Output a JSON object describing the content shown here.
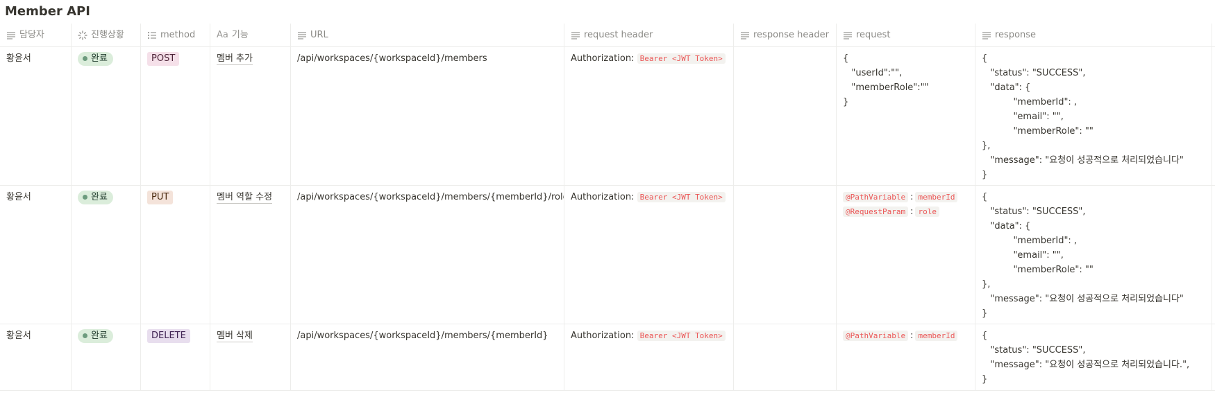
{
  "page": {
    "title": "Member API"
  },
  "columns": [
    {
      "label": "담당자",
      "icon": "text-lines-icon"
    },
    {
      "label": "진행상황",
      "icon": "status-spinner-icon"
    },
    {
      "label": "method",
      "icon": "list-icon"
    },
    {
      "label": "기능",
      "icon": "title-aa-icon",
      "prefix": "Aa"
    },
    {
      "label": "URL",
      "icon": "text-lines-icon"
    },
    {
      "label": "request header",
      "icon": "text-lines-icon"
    },
    {
      "label": "response header",
      "icon": "text-lines-icon"
    },
    {
      "label": "request",
      "icon": "text-lines-icon"
    },
    {
      "label": "response",
      "icon": "text-lines-icon"
    }
  ],
  "rows": [
    {
      "owner": "황윤서",
      "status": "완료",
      "method": "POST",
      "feature": "멤버 추가",
      "url": "/api/workspaces/{workspaceId}/members",
      "request_header": {
        "key": "Authorization:",
        "value": "Bearer <JWT Token>"
      },
      "response_header": "",
      "request": "{\n   \"userId\":\"\",\n   \"memberRole\":\"\"\n}",
      "response": "{\n   \"status\": \"SUCCESS\",\n   \"data\": {\n           \"memberId\": ,\n           \"email\": \"\",\n           \"memberRole\": \"\"\n},\n   \"message\": \"요청이 성공적으로 처리되었습니다\"\n}"
    },
    {
      "owner": "황윤서",
      "status": "완료",
      "method": "PUT",
      "feature": "멤버 역할 수정",
      "url": "/api/workspaces/{workspaceId}/members/{memberId}/role",
      "request_header": {
        "key": "Authorization:",
        "value": "Bearer <JWT Token>"
      },
      "response_header": "",
      "request_params": [
        {
          "annotation": "@PathVariable",
          "name": "memberId"
        },
        {
          "annotation": "@RequestParam",
          "name": "role"
        }
      ],
      "response": "{\n   \"status\": \"SUCCESS\",\n   \"data\": {\n           \"memberId\": ,\n           \"email\": \"\",\n           \"memberRole\": \"\"\n},\n   \"message\": \"요청이 성공적으로 처리되었습니다\"\n}"
    },
    {
      "owner": "황윤서",
      "status": "완료",
      "method": "DELETE",
      "feature": "멤버 삭제",
      "url": "/api/workspaces/{workspaceId}/members/{memberId}",
      "request_header": {
        "key": "Authorization:",
        "value": "Bearer <JWT Token>"
      },
      "response_header": "",
      "request_params": [
        {
          "annotation": "@PathVariable",
          "name": "memberId"
        }
      ],
      "response": "{\n   \"status\": \"SUCCESS\",\n   \"message\": \"요청이 성공적으로 처리되었습니다.\",\n}"
    }
  ],
  "colors": {
    "status_bg": "#dbeddb",
    "post_bg": "#f5e0e9",
    "put_bg": "#f4e3da",
    "delete_bg": "#e8deee",
    "code_text": "#eb5757"
  }
}
